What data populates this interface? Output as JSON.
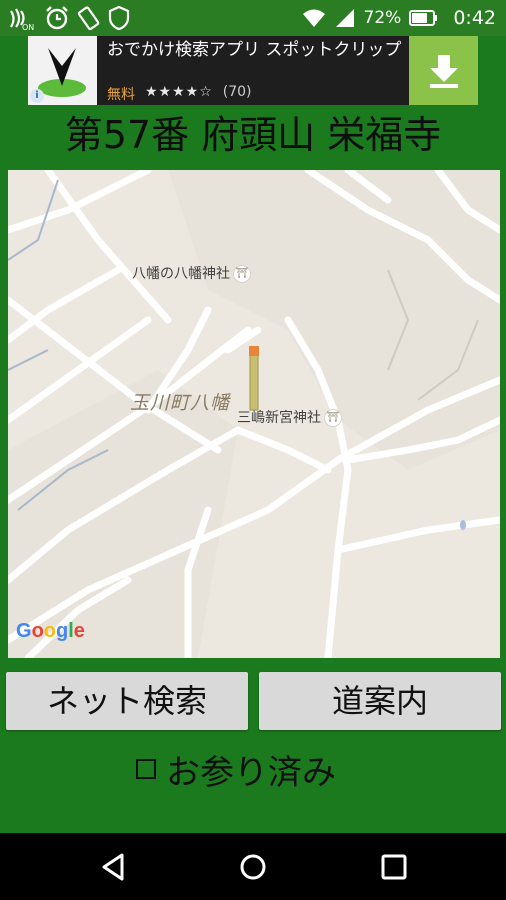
{
  "status_bar": {
    "battery": "72%",
    "time": "0:42",
    "icons": [
      "nfc-on-icon",
      "alarm-icon",
      "screen-rotation-icon",
      "shield-icon",
      "wifi-icon",
      "signal-icon",
      "battery-icon"
    ]
  },
  "ad": {
    "title": "おでかけ検索アプリ スポットクリップ",
    "price": "無料",
    "stars": "★★★★☆",
    "reviews": "(70)",
    "info_glyph": "i",
    "icon": "app-logo-icon",
    "install_icon": "download-icon"
  },
  "page": {
    "title": "第57番 府頭山 栄福寺"
  },
  "map": {
    "labels": {
      "shrine1": "八幡の八幡神社",
      "shrine2": "三嶋新宮神社",
      "area": "玉川町八幡"
    },
    "torii_glyph": "⛩",
    "google": [
      "G",
      "o",
      "o",
      "g",
      "l",
      "e"
    ],
    "google_colors": [
      "#4285f4",
      "#ea4335",
      "#fbbc05",
      "#4285f4",
      "#34a853",
      "#ea4335"
    ],
    "background": "#ece8e0"
  },
  "buttons": {
    "net_search": "ネット検索",
    "route": "道案内"
  },
  "visited": {
    "label": "お参り済み",
    "checked": false
  },
  "colors": {
    "background": "#1b7a1e",
    "status_bar": "#2a7d22",
    "ad_install": "#8bc34a"
  }
}
